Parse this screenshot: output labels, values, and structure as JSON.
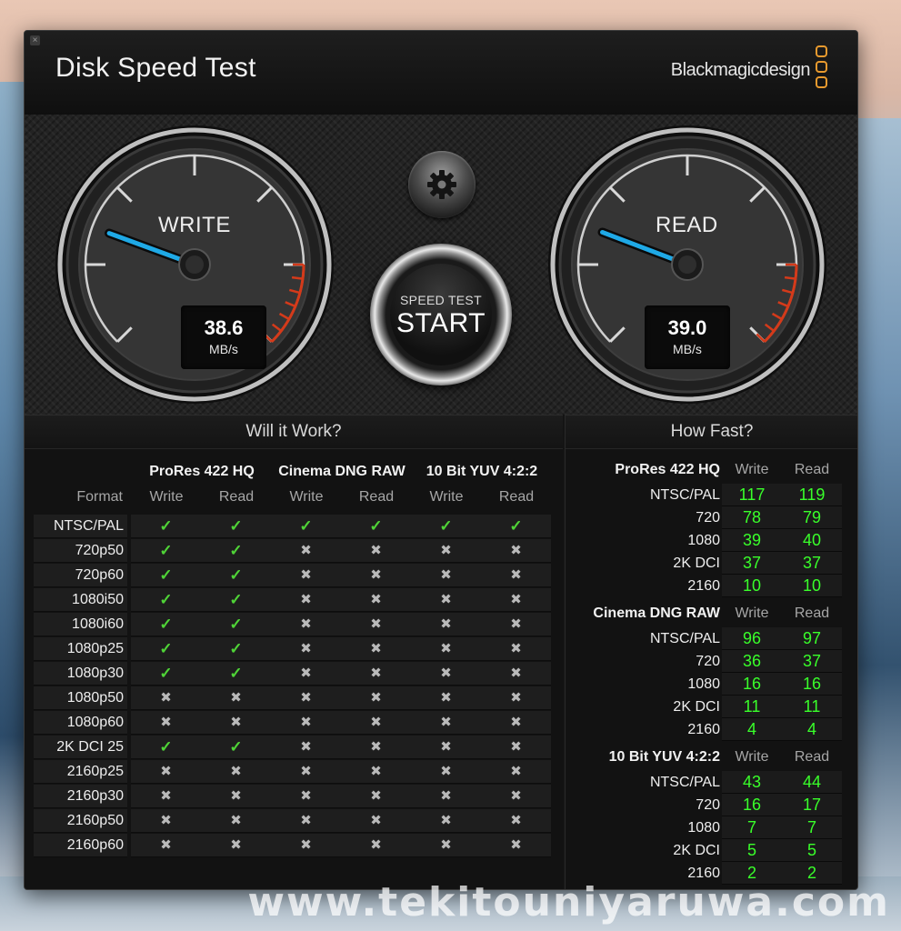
{
  "app": {
    "title": "Disk Speed Test",
    "brand": "Blackmagicdesign",
    "close_glyph": "×"
  },
  "colors": {
    "needle": "#1fa9e6",
    "redzone": "#d43a1a",
    "check": "#4fd337",
    "fast_value": "#39ff2a",
    "brand_logo": "#e89a2e"
  },
  "gauges": {
    "write": {
      "label": "WRITE",
      "value": "38.6",
      "unit": "MB/s",
      "level": 38.6
    },
    "read": {
      "label": "READ",
      "value": "39.0",
      "unit": "MB/s",
      "level": 39.0
    }
  },
  "buttons": {
    "settings_icon": "gear-icon",
    "start_sub": "SPEED TEST",
    "start_main": "START"
  },
  "will_it_work": {
    "header": "Will it Work?",
    "format_header": "Format",
    "groups": [
      "ProRes 422 HQ",
      "Cinema DNG RAW",
      "10 Bit YUV 4:2:2"
    ],
    "sub_headers": [
      "Write",
      "Read",
      "Write",
      "Read",
      "Write",
      "Read"
    ],
    "rows": [
      {
        "format": "NTSC/PAL",
        "cells": [
          true,
          true,
          true,
          true,
          true,
          true
        ]
      },
      {
        "format": "720p50",
        "cells": [
          true,
          true,
          false,
          false,
          false,
          false
        ]
      },
      {
        "format": "720p60",
        "cells": [
          true,
          true,
          false,
          false,
          false,
          false
        ]
      },
      {
        "format": "1080i50",
        "cells": [
          true,
          true,
          false,
          false,
          false,
          false
        ]
      },
      {
        "format": "1080i60",
        "cells": [
          true,
          true,
          false,
          false,
          false,
          false
        ]
      },
      {
        "format": "1080p25",
        "cells": [
          true,
          true,
          false,
          false,
          false,
          false
        ]
      },
      {
        "format": "1080p30",
        "cells": [
          true,
          true,
          false,
          false,
          false,
          false
        ]
      },
      {
        "format": "1080p50",
        "cells": [
          false,
          false,
          false,
          false,
          false,
          false
        ]
      },
      {
        "format": "1080p60",
        "cells": [
          false,
          false,
          false,
          false,
          false,
          false
        ]
      },
      {
        "format": "2K DCI 25",
        "cells": [
          true,
          true,
          false,
          false,
          false,
          false
        ]
      },
      {
        "format": "2160p25",
        "cells": [
          false,
          false,
          false,
          false,
          false,
          false
        ]
      },
      {
        "format": "2160p30",
        "cells": [
          false,
          false,
          false,
          false,
          false,
          false
        ]
      },
      {
        "format": "2160p50",
        "cells": [
          false,
          false,
          false,
          false,
          false,
          false
        ]
      },
      {
        "format": "2160p60",
        "cells": [
          false,
          false,
          false,
          false,
          false,
          false
        ]
      }
    ],
    "check_glyph": "✓",
    "cross_glyph": "✖"
  },
  "how_fast": {
    "header": "How Fast?",
    "write_label": "Write",
    "read_label": "Read",
    "groups": [
      {
        "name": "ProRes 422 HQ",
        "rows": [
          {
            "format": "NTSC/PAL",
            "write": "117",
            "read": "119"
          },
          {
            "format": "720",
            "write": "78",
            "read": "79"
          },
          {
            "format": "1080",
            "write": "39",
            "read": "40"
          },
          {
            "format": "2K DCI",
            "write": "37",
            "read": "37"
          },
          {
            "format": "2160",
            "write": "10",
            "read": "10"
          }
        ]
      },
      {
        "name": "Cinema DNG RAW",
        "rows": [
          {
            "format": "NTSC/PAL",
            "write": "96",
            "read": "97"
          },
          {
            "format": "720",
            "write": "36",
            "read": "37"
          },
          {
            "format": "1080",
            "write": "16",
            "read": "16"
          },
          {
            "format": "2K DCI",
            "write": "11",
            "read": "11"
          },
          {
            "format": "2160",
            "write": "4",
            "read": "4"
          }
        ]
      },
      {
        "name": "10 Bit YUV 4:2:2",
        "rows": [
          {
            "format": "NTSC/PAL",
            "write": "43",
            "read": "44"
          },
          {
            "format": "720",
            "write": "16",
            "read": "17"
          },
          {
            "format": "1080",
            "write": "7",
            "read": "7"
          },
          {
            "format": "2K DCI",
            "write": "5",
            "read": "5"
          },
          {
            "format": "2160",
            "write": "2",
            "read": "2"
          }
        ]
      }
    ]
  },
  "watermark": "www.tekitouniyaruwa.com"
}
